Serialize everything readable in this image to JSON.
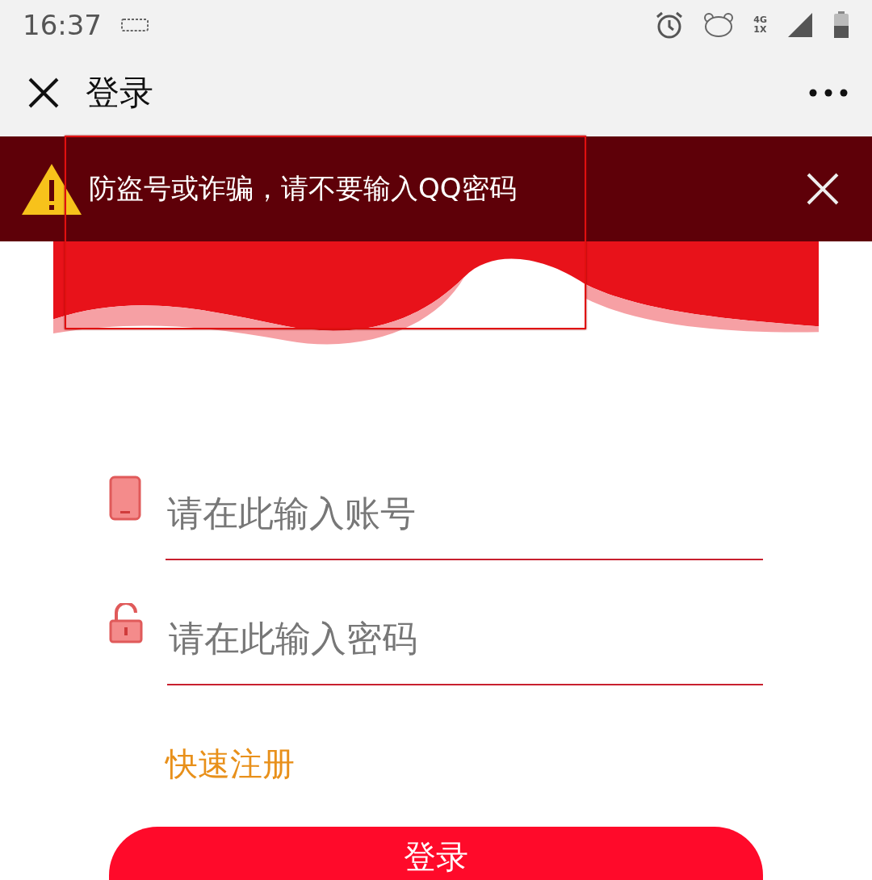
{
  "status_bar": {
    "time": "16:37",
    "network_top": "4G",
    "network_bottom": "1X"
  },
  "nav_bar": {
    "title": "登录"
  },
  "warning_banner": {
    "text": "防盗号或诈骗，请不要输入QQ密码"
  },
  "fields": [
    {
      "kind": "account",
      "placeholder": "请在此输入账号"
    },
    {
      "kind": "password",
      "placeholder": "请在此输入密码"
    }
  ],
  "register_link": "快速注册",
  "login_button": "登录"
}
